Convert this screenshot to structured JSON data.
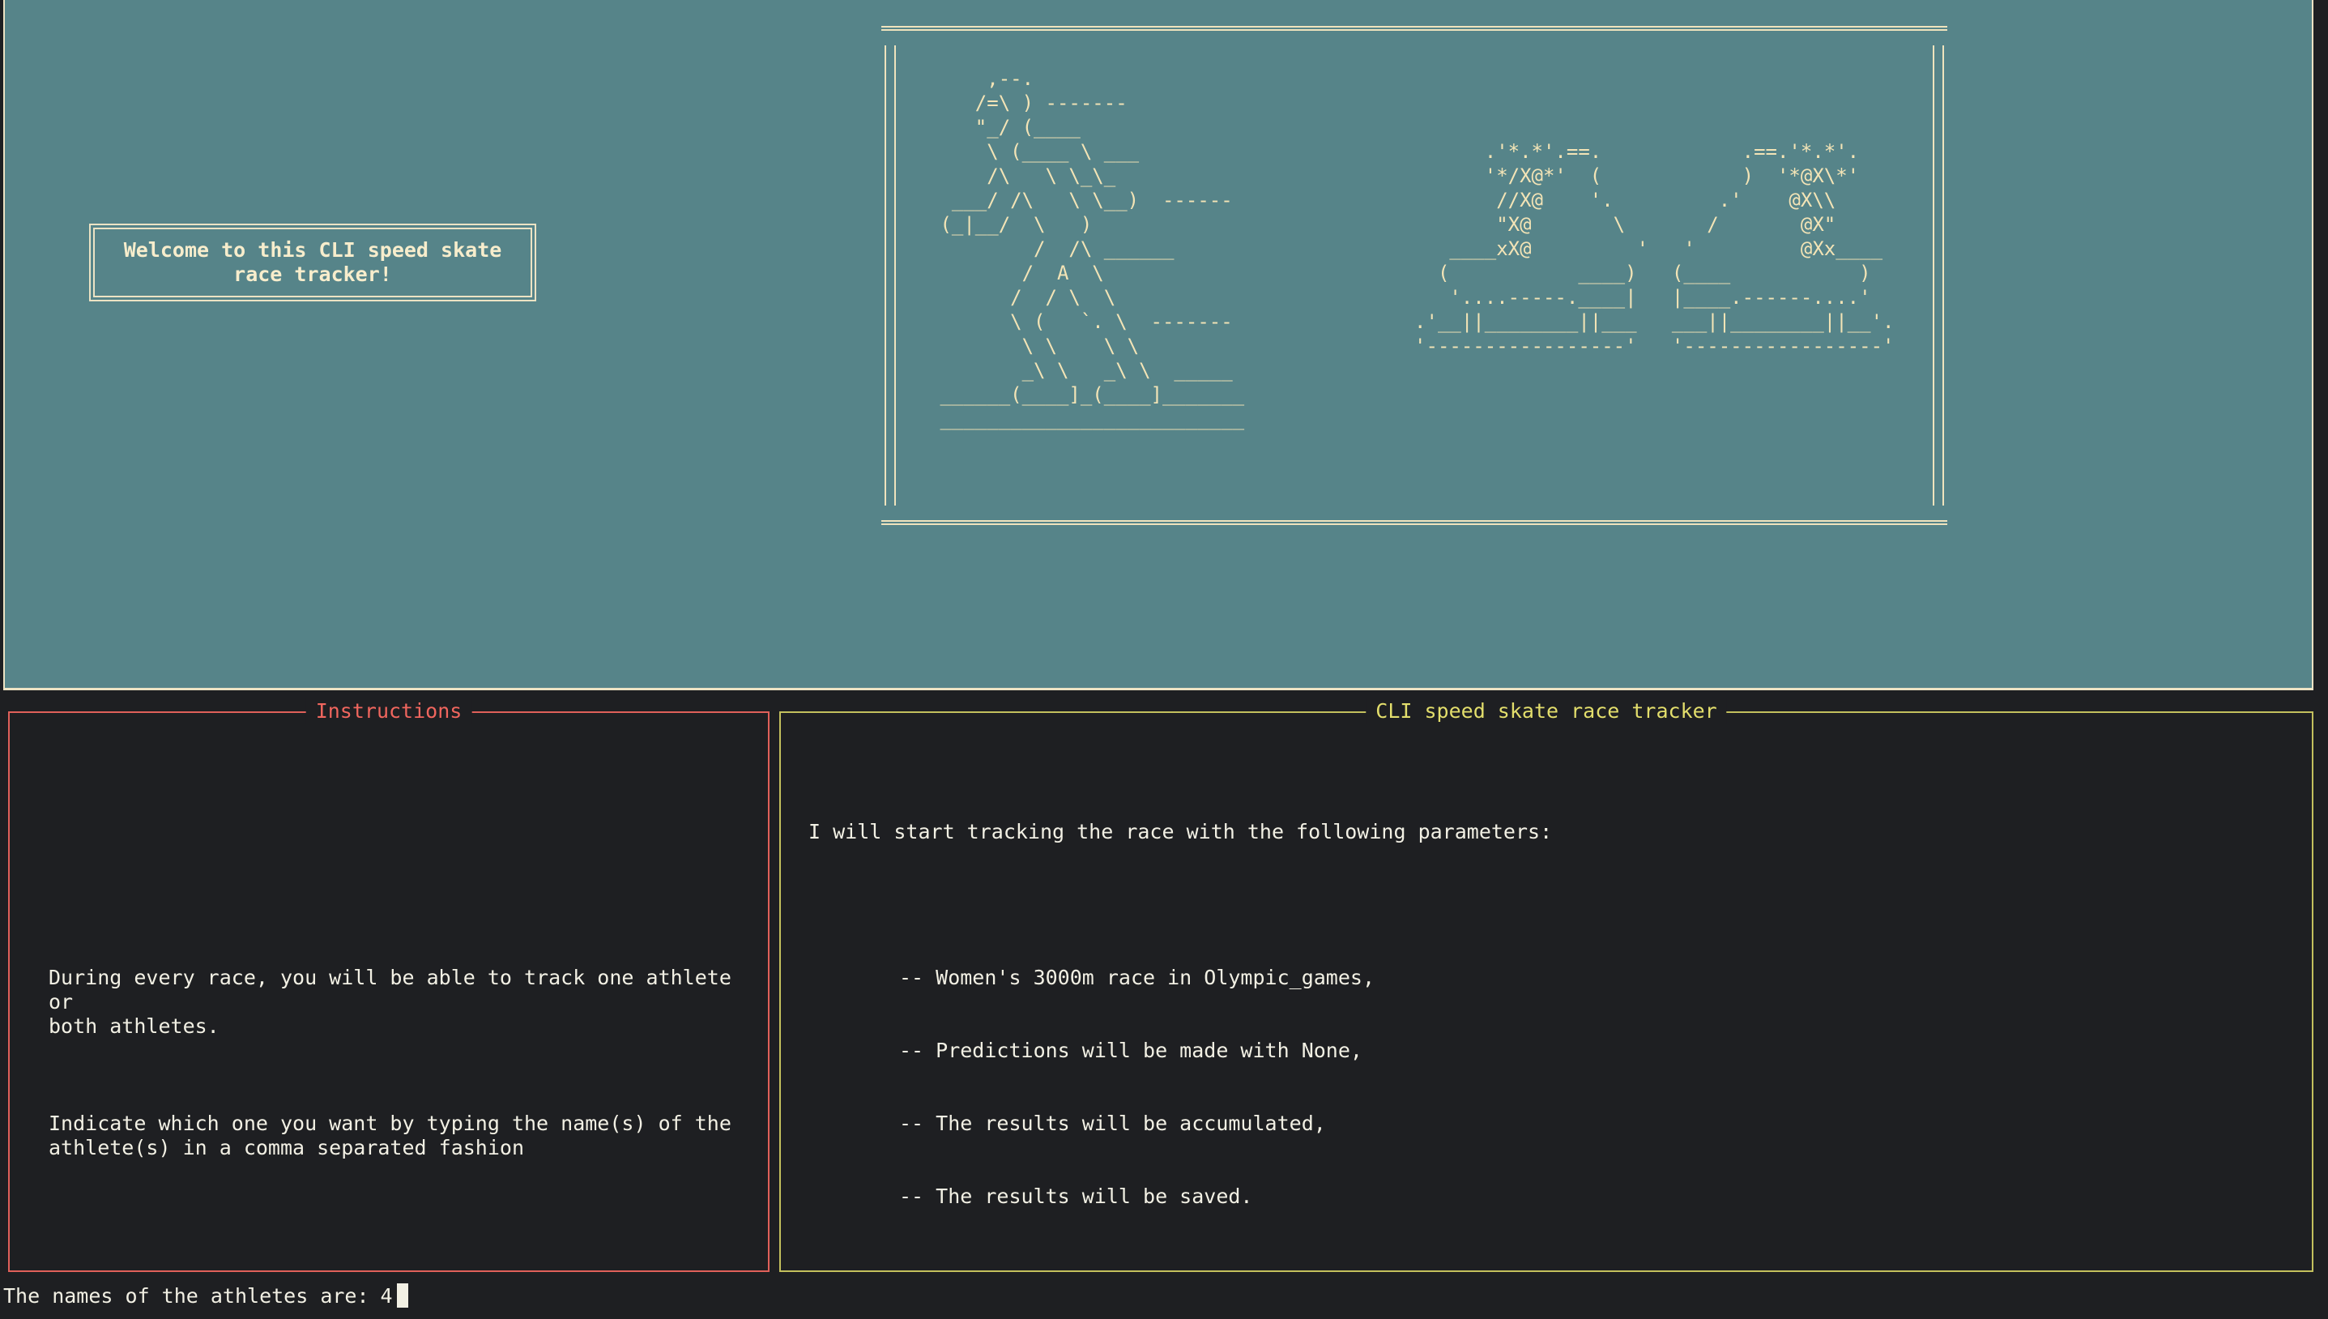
{
  "banner": {
    "welcome_text": "Welcome to this CLI speed skate race tracker!",
    "ascii_art": "     ,--.\n    /=\\ ) -------\n    \"_/ (____\n     \\ (____ \\ ___\n     /\\   \\ \\_\\_\n  ___/ /\\   \\ \\__)  ------\n (_|__/  \\   )\n         /  /\\ ______\n        /  A  \\\n       /  / \\  \\\n       \\ (   `. \\  -------\n        \\ \\    \\ \\\n        _\\ \\   _\\ \\  _____\n ______(____]_(____]_______\n __________________________",
    "ascii_art_skates": "               .'*.*'.==.            .==.'*.*'.\n               '*/X@*'  (            )  '*@X\\*'\n                //X@    '.         .'    @X\\\\\n                \"X@       \\       /       @X\"\n            ____xX@         '   '         @Xx____\n           (           ____)   (____           )\n            '....-----.____|   |____.------....'\n         .'__||________||___   ___||________||__'.\n         '-----------------'   '-----------------'"
  },
  "instructions": {
    "title": "Instructions",
    "paragraph_1": "During every race, you will be able to track one athlete or\nboth athletes.",
    "paragraph_2": "Indicate which one you want by typing the name(s) of the\nathlete(s) in a comma separated fashion"
  },
  "tracker": {
    "title": "CLI speed skate race tracker",
    "lead": "I will start tracking the race with the following parameters:",
    "params": [
      "-- Women's 3000m race in Olympic_games,",
      "-- Predictions will be made with None,",
      "-- The results will be accumulated,",
      "-- The results will be saved."
    ]
  },
  "prompt": {
    "label": "The names of the athletes are:",
    "value": "4"
  },
  "colors": {
    "banner_bg": "#568489",
    "terminal_bg": "#1e1f22",
    "instructions_border": "#e0605a",
    "tracker_border": "#c3c05d",
    "art_text": "#f3e4b6"
  }
}
